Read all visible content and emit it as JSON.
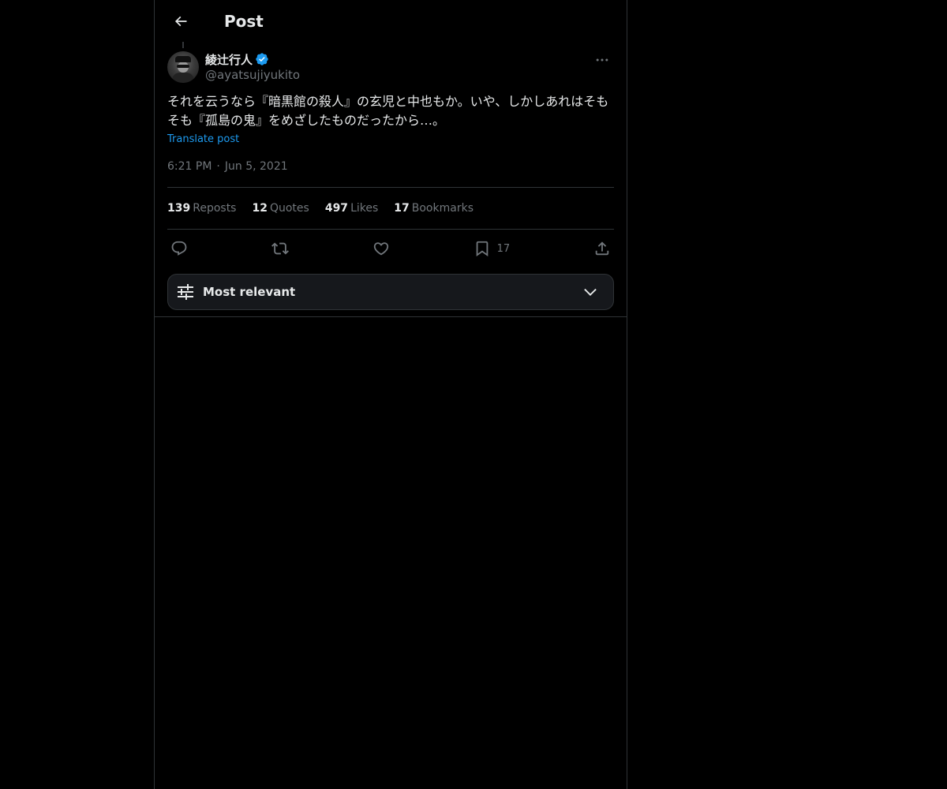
{
  "header": {
    "title": "Post",
    "back_icon": "back-arrow-icon"
  },
  "post": {
    "author": {
      "display_name": "綾辻行人",
      "handle": "@ayatsujiyukito",
      "verified": true,
      "verified_color": "#1d9bf0"
    },
    "text": "それを云うなら『暗黒館の殺人』の玄児と中也もか。いや、しかしあれはそもそも『孤島の鬼』をめざしたものだったから…。",
    "translate_label": "Translate post",
    "time": "6:21 PM",
    "date": "Jun 5, 2021",
    "separator": "·"
  },
  "stats": {
    "reposts": {
      "count": "139",
      "label": "Reposts"
    },
    "quotes": {
      "count": "12",
      "label": "Quotes"
    },
    "likes": {
      "count": "497",
      "label": "Likes"
    },
    "bookmarks": {
      "count": "17",
      "label": "Bookmarks"
    }
  },
  "actions": {
    "reply_icon": "reply-icon",
    "repost_icon": "repost-icon",
    "like_icon": "like-icon",
    "bookmark_icon": "bookmark-icon",
    "bookmark_count": "17",
    "share_icon": "share-icon"
  },
  "sort": {
    "label": "Most relevant",
    "icon": "sliders-icon"
  },
  "colors": {
    "background": "#000000",
    "text_primary": "#e7e9ea",
    "text_secondary": "#71767b",
    "accent": "#1d9bf0",
    "border": "#2f3336"
  }
}
